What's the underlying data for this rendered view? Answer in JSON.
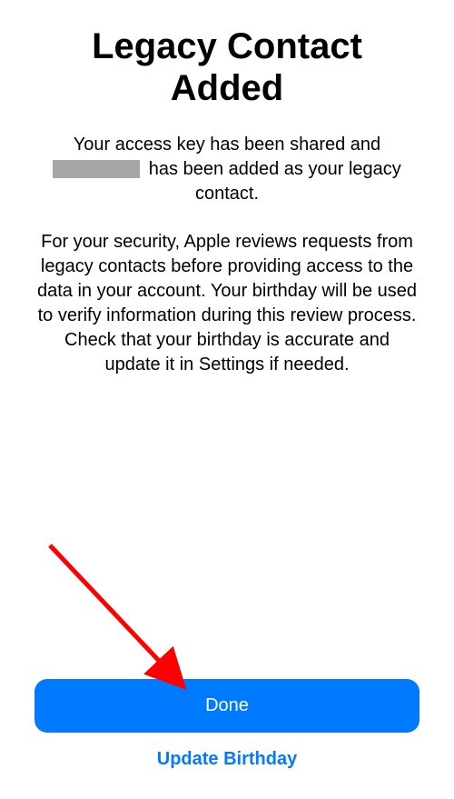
{
  "title": "Legacy Contact Added",
  "paragraph1_part1": "Your access key has been shared and ",
  "paragraph1_part2": " has been added as your legacy contact.",
  "paragraph2": "For your security, Apple reviews requests from legacy contacts before providing access to the data in your account. Your birthday will be used to verify information during this review process. Check that your birthday is accurate and update it in Settings if needed.",
  "buttons": {
    "done": "Done",
    "update_birthday": "Update Birthday"
  }
}
